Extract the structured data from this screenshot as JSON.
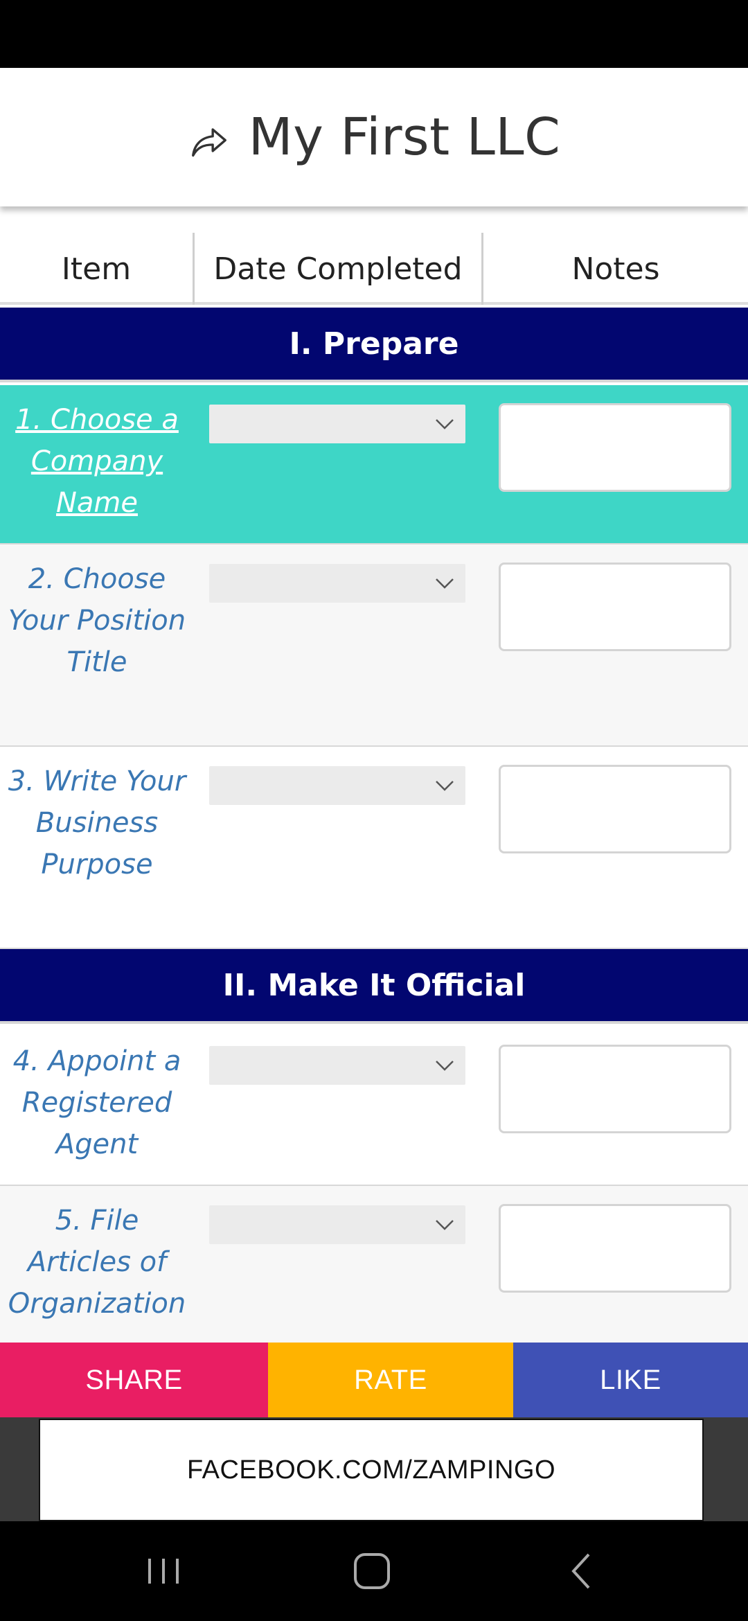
{
  "header": {
    "title": "My First LLC",
    "share_icon": "share-arrow-icon"
  },
  "columns": [
    "Item",
    "Date Completed",
    "Notes"
  ],
  "sections": [
    {
      "title": "I. Prepare"
    },
    {
      "title": "II. Make It Official"
    }
  ],
  "rows": [
    {
      "label": "1. Choose a Company Name",
      "date_value": "",
      "notes_value": ""
    },
    {
      "label": "2. Choose Your Position Title",
      "date_value": "",
      "notes_value": ""
    },
    {
      "label": "3. Write Your Business Purpose",
      "date_value": "",
      "notes_value": ""
    },
    {
      "label": "4. Appoint a Registered Agent",
      "date_value": "",
      "notes_value": ""
    },
    {
      "label": "5. File Articles of Organization",
      "date_value": "",
      "notes_value": ""
    }
  ],
  "actions": {
    "share": "SHARE",
    "rate": "RATE",
    "like": "LIKE"
  },
  "ad": {
    "text": "FACEBOOK.COM/ZAMPINGO"
  },
  "colors": {
    "section_band": "#020670",
    "active_row": "#3ed6c6",
    "link_text": "#3a77b3",
    "share": "#e91e63",
    "rate": "#ffb300",
    "like": "#3f51b5"
  },
  "nav": {
    "recents": "recents-icon",
    "home": "home-icon",
    "back": "back-icon"
  }
}
